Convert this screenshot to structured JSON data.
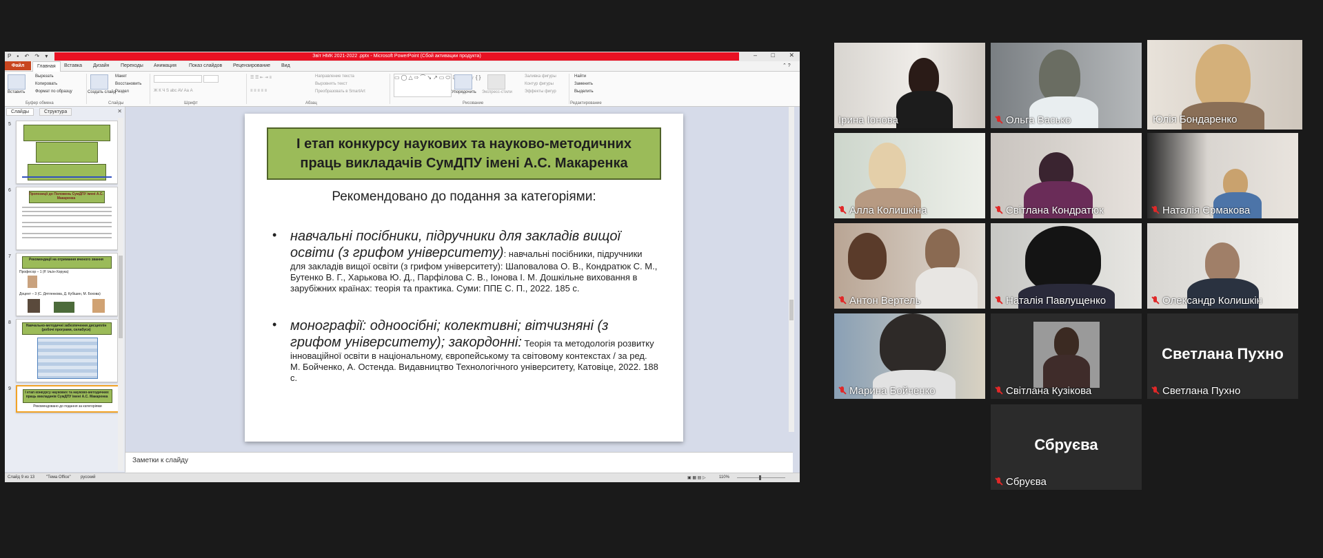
{
  "window": {
    "title": "Звіт НМК 2021-2022 .pptx - Microsoft PowerPoint (Сбой активации продукта)",
    "buttons": [
      "–",
      "□",
      "✕"
    ]
  },
  "ribbon_tabs": [
    "Файл",
    "Главная",
    "Вставка",
    "Дизайн",
    "Переходы",
    "Анимация",
    "Показ слайдов",
    "Рецензирование",
    "Вид"
  ],
  "ribbon": {
    "clipboard": {
      "paste": "Вставить",
      "cut": "Вырезать",
      "copy": "Копировать",
      "format": "Формат по образцу",
      "label": "Буфер обмена"
    },
    "slides": {
      "new": "Создать слайд",
      "layout": "Макет",
      "reset": "Восстановить",
      "section": "Раздел",
      "label": "Слайды"
    },
    "font": {
      "label": "Шрифт"
    },
    "paragraph": {
      "direction": "Направление текста",
      "align": "Выровнять текст",
      "smartart": "Преобразовать в SmartArt",
      "label": "Абзац"
    },
    "drawing": {
      "arrange": "Упорядочить",
      "styles": "Экспресс-стили",
      "fill": "Заливка фигуры",
      "outline": "Контур фигуры",
      "effects": "Эффекты фигур",
      "label": "Рисование"
    },
    "editing": {
      "find": "Найти",
      "replace": "Заменить",
      "select": "Выделить",
      "label": "Редактирование"
    }
  },
  "left_pane": {
    "tabs": [
      "Слайды",
      "Структура"
    ],
    "thumbnails": [
      {
        "num": "5"
      },
      {
        "num": "6",
        "title": "Пропозиції до Положень СумДПУ імені А.С. Макаренка"
      },
      {
        "num": "7",
        "title": "Рекомендації на отримання вченого звання",
        "line1": "Професор – 1 (Р. Ільїн-Хорука)",
        "line2": "Доцент – 3 (С. Дятленкова, Д. Кубішин, М. Бохова)"
      },
      {
        "num": "8",
        "title": "Навчально-методичні забезпечення дисциплін (робочі програми, силабуси)"
      },
      {
        "num": "9",
        "title": "І етап конкурсу наукових та науково-методичних праць викладачів СумДПУ імені А.С. Макаренка",
        "line1": "Рекомендовано до подання за категоріями"
      }
    ]
  },
  "slide": {
    "title": "І етап конкурсу наукових та науково-методичних праць викладачів СумДПУ імені А.С. Макаренка",
    "subtitle": "Рекомендовано до подання за категоріями:",
    "bullet1": {
      "lead": "навчальні посібники, підручники для закладів вищої освіти (з грифом університету)",
      "text": ": навчальні посібники, підручники для закладів вищої освіти (з грифом університету): Шаповалова О. В., Кондратюк С. М., Бутенко В. Г., Харькова Ю. Д., Парфілова С. В., Іонова І. М. Дошкільне виховання в зарубіжних країнах: теорія та практика. Суми: ППЕ С. П., 2022. 185 с."
    },
    "bullet2": {
      "lead": "монографії: одноосібні; колективні; вітчизняні (з грифом університету); закордонні:",
      "text": " Теорія та методологія розвитку інноваційної освіти в національному, європейському та світовому контекстах / за ред. М. Бойченко, А. Остенда. Видавництво Технологічного університету, Катовіце, 2022. 188 с."
    }
  },
  "notes_placeholder": "Заметки к слайду",
  "status": {
    "slide": "Слайд 9 из 13",
    "theme": "\"Тема Office\"",
    "lang": "русский",
    "zoom": "110%"
  },
  "participants": [
    {
      "name": "Ірина Іонова",
      "muted": false
    },
    {
      "name": "Ольга Васько",
      "muted": true
    },
    {
      "name": "Юлія Бондаренко",
      "muted": false,
      "speaking": true
    },
    {
      "name": "Алла Колишкіна",
      "muted": true
    },
    {
      "name": "Світлана Кондратюк",
      "muted": true
    },
    {
      "name": "Наталія  Єрмакова",
      "muted": true
    },
    {
      "name": "Антон Вертель",
      "muted": true
    },
    {
      "name": "Наталія Павлущенко",
      "muted": true
    },
    {
      "name": "Олександр Колишкін",
      "muted": true
    },
    {
      "name": "Марина Бойченко",
      "muted": true
    },
    {
      "name": "Світлана Кузікова",
      "muted": true
    },
    {
      "name": "Светлана Пухно",
      "muted": true,
      "video_off_label": "Светлана Пухно"
    },
    {
      "name": "Сбруєва",
      "muted": true,
      "video_off_label": "Сбруєва"
    }
  ]
}
